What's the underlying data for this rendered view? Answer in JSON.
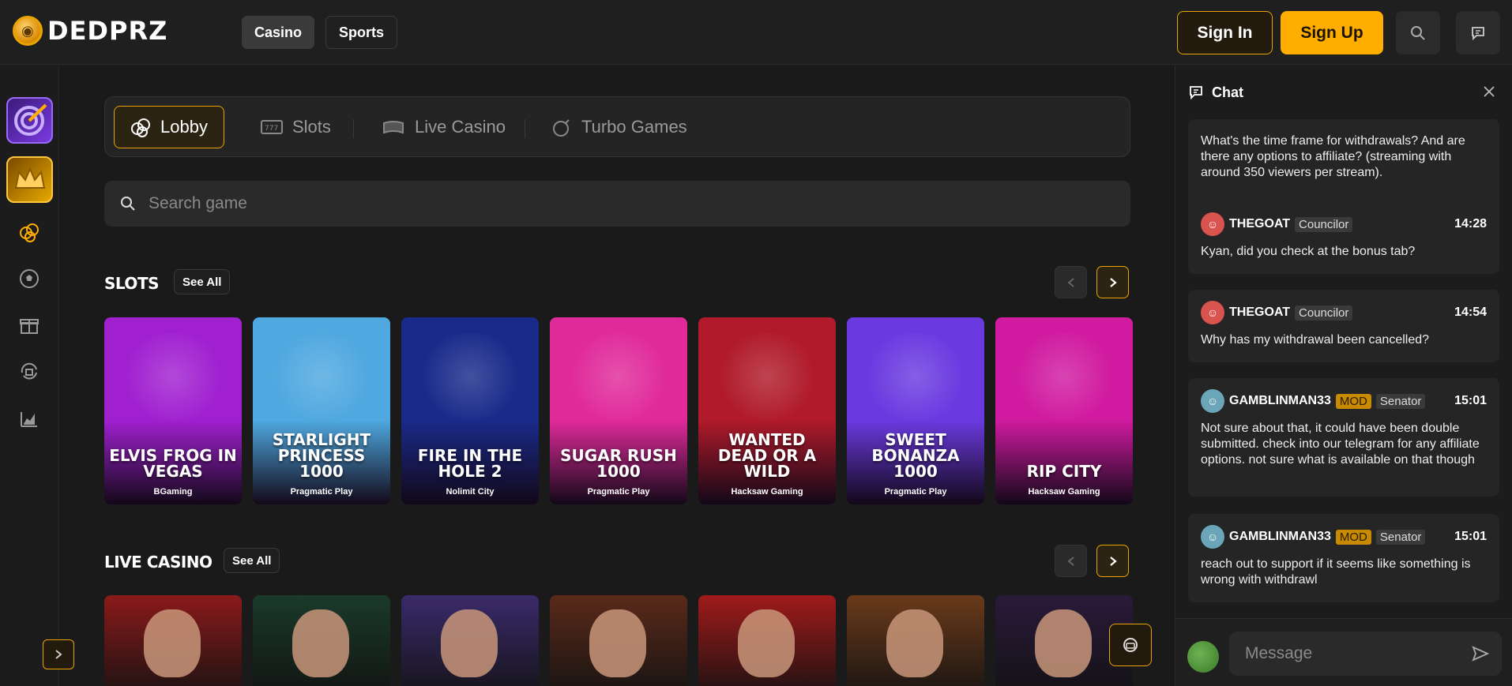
{
  "header": {
    "logo_text": "DEDPRZ",
    "nav": [
      {
        "label": "Casino",
        "active": true
      },
      {
        "label": "Sports",
        "active": false
      }
    ],
    "sign_in": "Sign In",
    "sign_up": "Sign Up",
    "accent_color": "#ffae00"
  },
  "sidebar": {
    "icons": [
      "casino-chips-icon",
      "soccer-ball-icon",
      "gift-icon",
      "refresh-shield-icon",
      "stats-chart-icon"
    ]
  },
  "tabs": [
    {
      "label": "Lobby",
      "icon": "chips-icon",
      "active": true
    },
    {
      "label": "Slots",
      "icon": "slot-machine-icon",
      "active": false
    },
    {
      "label": "Live Casino",
      "icon": "game-controller-icon",
      "active": false
    },
    {
      "label": "Turbo Games",
      "icon": "bomb-icon",
      "active": false
    }
  ],
  "search": {
    "placeholder": "Search game"
  },
  "slots": {
    "title": "SLOTS",
    "see_all": "See All",
    "games": [
      {
        "name": "Elvis Frog in Vegas",
        "provider": "BGaming",
        "color": "#a020d0"
      },
      {
        "name": "Starlight Princess 1000",
        "provider": "Pragmatic Play",
        "color": "#4fa8e0"
      },
      {
        "name": "Fire in the Hole 2",
        "provider": "Nolimit City",
        "color": "#1a2a8a"
      },
      {
        "name": "Sugar Rush 1000",
        "provider": "Pragmatic Play",
        "color": "#e02a9a"
      },
      {
        "name": "Wanted Dead or a Wild",
        "provider": "Hacksaw Gaming",
        "color": "#b01a2a"
      },
      {
        "name": "Sweet Bonanza 1000",
        "provider": "Pragmatic Play",
        "color": "#6a3ae0"
      },
      {
        "name": "Rip City",
        "provider": "Hacksaw Gaming",
        "color": "#d01aa0"
      }
    ]
  },
  "live_casino": {
    "title": "LIVE CASINO",
    "see_all": "See All",
    "tables": [
      {
        "color": "#8a1a1a"
      },
      {
        "color": "#1a3a2a"
      },
      {
        "color": "#3a2a6a"
      },
      {
        "color": "#5a2a1a"
      },
      {
        "color": "#a01a1a"
      },
      {
        "color": "#6a3a1a"
      },
      {
        "color": "#2a1a3a"
      }
    ]
  },
  "chat": {
    "title": "Chat",
    "input_placeholder": "Message",
    "messages": [
      {
        "text": "What's the time frame for withdrawals? And are there any options to affiliate? (streaming with around 350 viewers per stream)."
      },
      {
        "user": "THEGOAT",
        "rank": "Councilor",
        "time": "14:28",
        "text": "Kyan, did you check at the bonus tab?"
      },
      {
        "user": "THEGOAT",
        "rank": "Councilor",
        "time": "14:54",
        "text": "Why has my withdrawal been cancelled?"
      },
      {
        "user": "GAMBLINMAN33",
        "mod": "MOD",
        "rank": "Senator",
        "time": "15:01",
        "text": "Not sure about that, it could have been double submitted. check into our telegram for any affiliate options. not sure what is available on that though"
      },
      {
        "user": "GAMBLINMAN33",
        "mod": "MOD",
        "rank": "Senator",
        "time": "15:01",
        "text": "reach out to support if it seems like something is wrong with withdrawl"
      }
    ]
  }
}
